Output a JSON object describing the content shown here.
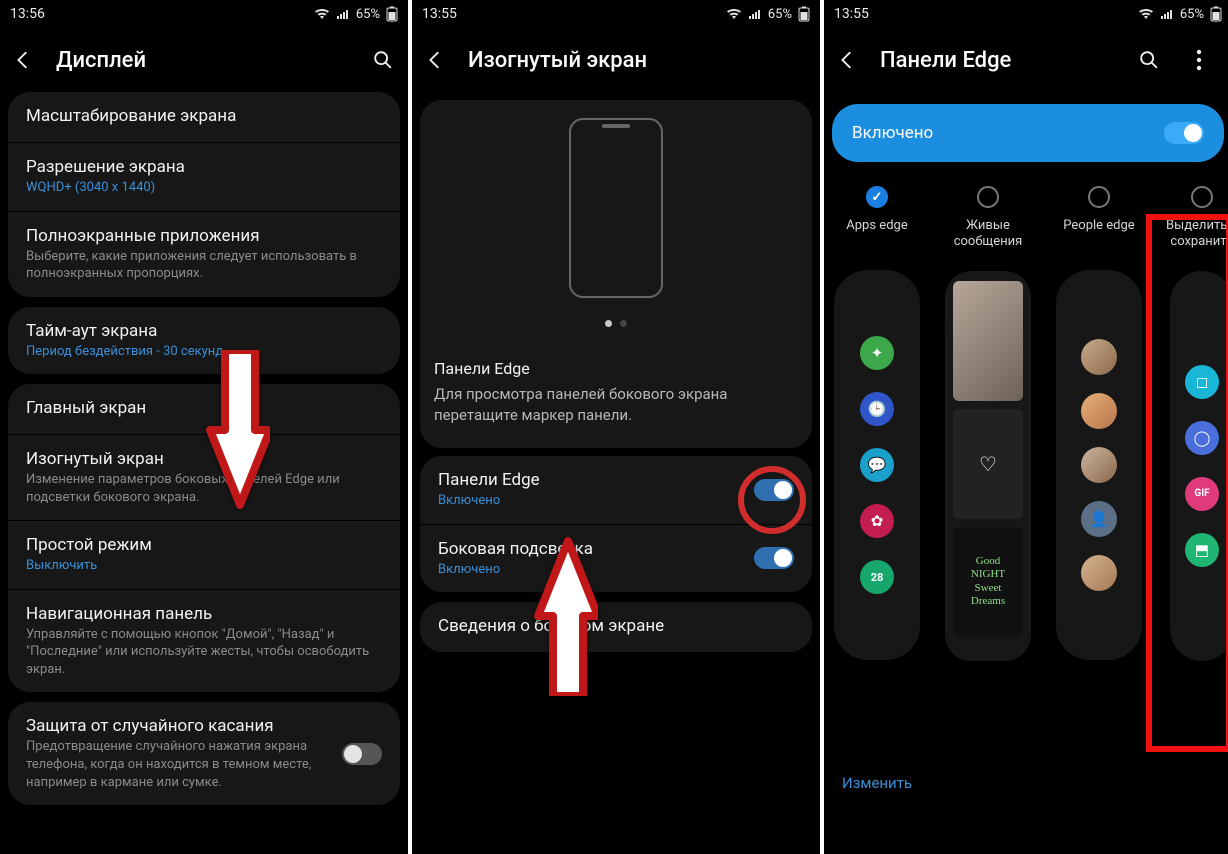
{
  "status": {
    "time1": "13:56",
    "time2": "13:55",
    "time3": "13:55",
    "battery": "65%"
  },
  "phone1": {
    "headerTitle": "Дисплей",
    "items": {
      "scaling": "Масштабирование экрана",
      "resolution": "Разрешение экрана",
      "resolution_sub": "WQHD+ (3040 x 1440)",
      "fullscreen": "Полноэкранные приложения",
      "fullscreen_sub": "Выберите, какие приложения следует использовать в полноэкранных пропорциях.",
      "timeout": "Тайм-аут экрана",
      "timeout_sub": "Период бездействия - 30 секунд",
      "home": "Главный экран",
      "edge": "Изогнутый экран",
      "edge_sub": "Изменение параметров боковых панелей Edge или подсветки бокового экрана.",
      "easy": "Простой режим",
      "easy_sub": "Выключить",
      "nav": "Навигационная панель",
      "nav_sub": "Управляйте с помощью кнопок \"Домой\", \"Назад\" и \"Последние\" или используйте жесты, чтобы освободить экран.",
      "touch": "Защита от случайного касания",
      "touch_sub": "Предотвращение случайного нажатия экрана телефона, когда он находится в темном месте, например в кармане или сумке."
    }
  },
  "phone2": {
    "headerTitle": "Изогнутый экран",
    "captionTitle": "Панели Edge",
    "captionBody": "Для просмотра панелей бокового экрана перетащите маркер панели.",
    "items": {
      "panels": "Панели Edge",
      "panels_sub": "Включено",
      "lighting": "Боковая подсветка",
      "lighting_sub": "Включено",
      "info": "Сведения о боковом экране"
    }
  },
  "phone3": {
    "headerTitle": "Панели Edge",
    "enabledLabel": "Включено",
    "panels": {
      "apps": "Apps edge",
      "live": "Живые\nсообщения",
      "people": "People edge",
      "select": "Выделить и\nсохранить"
    },
    "editLink": "Изменить",
    "previewText": {
      "goodnight": "Good\nNIGHT\nSweet\nDreams",
      "calendarDay": "28",
      "gif": "GIF"
    }
  }
}
